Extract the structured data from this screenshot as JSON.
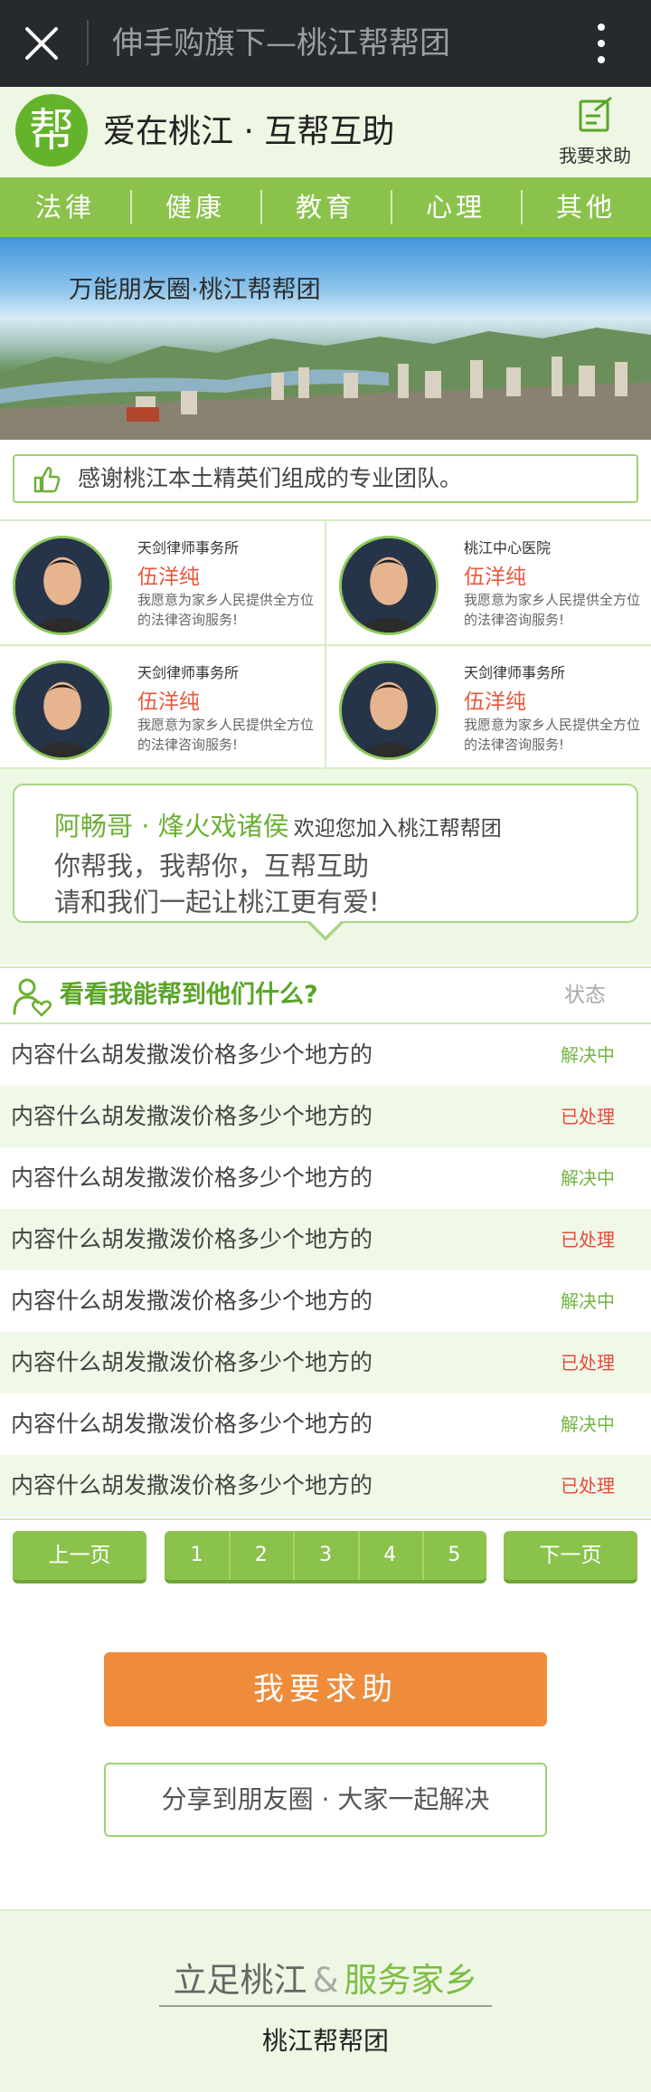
{
  "topbar": {
    "title": "伸手购旗下—桃江帮帮团",
    "close_icon": "close-icon",
    "more_icon": "more-vertical-icon"
  },
  "header": {
    "logo_char": "帮",
    "title": "爱在桃江 · 互帮互助",
    "help_link_label": "我要求助",
    "help_icon": "edit-note-icon"
  },
  "categories": [
    "法律",
    "健康",
    "教育",
    "心理",
    "其他"
  ],
  "banner": {
    "text": "万能朋友圈·桃江帮帮团"
  },
  "thanks": {
    "text": "感谢桃江本土精英们组成的专业团队。",
    "icon": "thumbs-up-icon"
  },
  "experts": [
    {
      "org": "天剑律师事务所",
      "name": "伍洋纯",
      "desc": "我愿意为家乡人民提供全方位的法律咨询服务!"
    },
    {
      "org": "桃江中心医院",
      "name": "伍洋纯",
      "desc": "我愿意为家乡人民提供全方位的法律咨询服务!"
    },
    {
      "org": "天剑律师事务所",
      "name": "伍洋纯",
      "desc": "我愿意为家乡人民提供全方位的法律咨询服务!"
    },
    {
      "org": "天剑律师事务所",
      "name": "伍洋纯",
      "desc": "我愿意为家乡人民提供全方位的法律咨询服务!"
    }
  ],
  "message": {
    "nickname": "阿畅哥 · 烽火戏诸侯",
    "welcome": "欢迎您加入桃江帮帮团",
    "line2": "你帮我，我帮你，互帮互助",
    "line3": "请和我们一起让桃江更有爱!"
  },
  "list": {
    "title": "看看我能帮到他们什么?",
    "status_header": "状态",
    "rows": [
      {
        "text": "内容什么胡发撒泼价格多少个地方的",
        "status": "解决中",
        "color": "#74b543"
      },
      {
        "text": "内容什么胡发撒泼价格多少个地方的",
        "status": "已处理",
        "color": "#e9493a"
      },
      {
        "text": "内容什么胡发撒泼价格多少个地方的",
        "status": "解决中",
        "color": "#74b543"
      },
      {
        "text": "内容什么胡发撒泼价格多少个地方的",
        "status": "已处理",
        "color": "#e9493a"
      },
      {
        "text": "内容什么胡发撒泼价格多少个地方的",
        "status": "解决中",
        "color": "#74b543"
      },
      {
        "text": "内容什么胡发撒泼价格多少个地方的",
        "status": "已处理",
        "color": "#e9493a"
      },
      {
        "text": "内容什么胡发撒泼价格多少个地方的",
        "status": "解决中",
        "color": "#74b543"
      },
      {
        "text": "内容什么胡发撒泼价格多少个地方的",
        "status": "已处理",
        "color": "#e9493a"
      }
    ]
  },
  "pager": {
    "prev": "上一页",
    "next": "下一页",
    "pages": [
      "1",
      "2",
      "3",
      "4",
      "5"
    ]
  },
  "actions": {
    "help": "我要求助",
    "share": "分享到朋友圈 · 大家一起解决"
  },
  "footer": {
    "slogan_left": "立足桃江",
    "slogan_amp": "&",
    "slogan_right": "服务家乡",
    "team": "桃江帮帮团"
  },
  "colors": {
    "primary_green": "#8bc24c",
    "accent_orange": "#ee8c3c",
    "status_red": "#e9493a",
    "status_green": "#74b543"
  }
}
